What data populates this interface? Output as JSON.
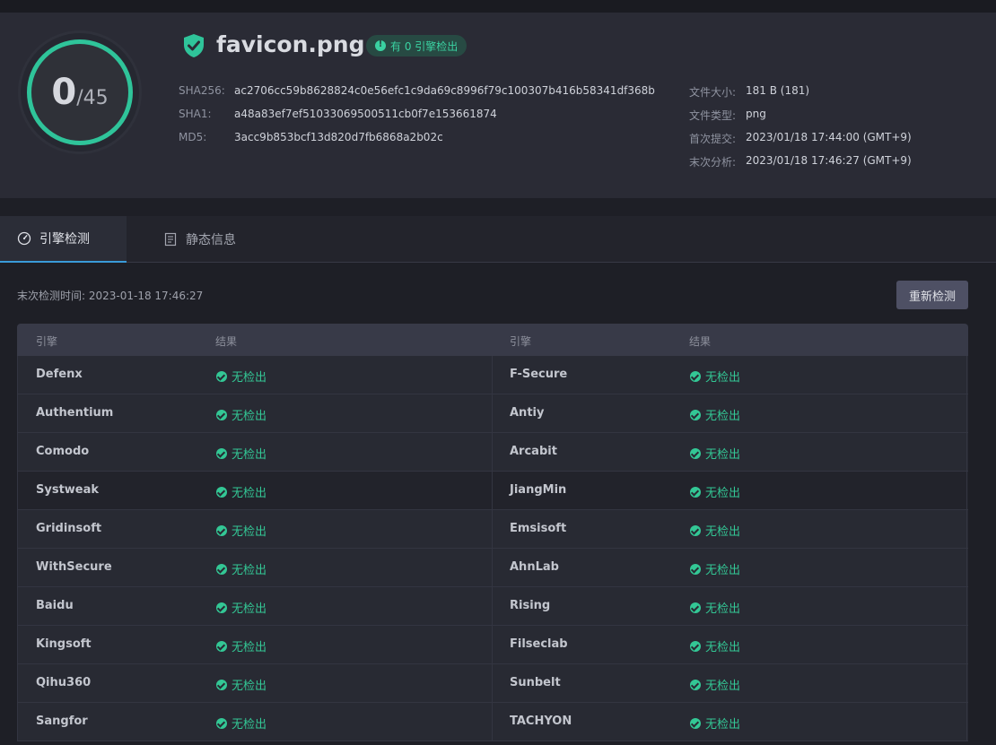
{
  "score": {
    "detected": "0",
    "total": "/45"
  },
  "file": {
    "name": "favicon.png",
    "badge": "有 0 引擎检出"
  },
  "hashes": [
    {
      "key": "SHA256:",
      "value": "ac2706cc59b8628824c0e56efc1c9da69c8996f79c100307b416b58341df368b"
    },
    {
      "key": "SHA1:",
      "value": "a48a83ef7ef51033069500511cb0f7e153661874"
    },
    {
      "key": "MD5:",
      "value": "3acc9b853bcf13d820d7fb6868a2b02c"
    }
  ],
  "meta": [
    {
      "key": "文件大小:",
      "value": "181 B (181)"
    },
    {
      "key": "文件类型:",
      "value": "png"
    },
    {
      "key": "首次提交:",
      "value": "2023/01/18 17:44:00 (GMT+9)"
    },
    {
      "key": "末次分析:",
      "value": "2023/01/18 17:46:27 (GMT+9)"
    }
  ],
  "tabs": {
    "engine": "引擎检测",
    "static": "静态信息"
  },
  "last_check": "末次检测时间: 2023-01-18 17:46:27",
  "rescan_label": "重新检测",
  "table": {
    "headers": {
      "engine": "引擎",
      "result": "结果"
    },
    "rows": [
      {
        "left": {
          "engine": "Defenx",
          "result": "无检出"
        },
        "right": {
          "engine": "F-Secure",
          "result": "无检出"
        }
      },
      {
        "left": {
          "engine": "Authentium",
          "result": "无检出"
        },
        "right": {
          "engine": "Antiy",
          "result": "无检出"
        }
      },
      {
        "left": {
          "engine": "Comodo",
          "result": "无检出"
        },
        "right": {
          "engine": "Arcabit",
          "result": "无检出"
        }
      },
      {
        "left": {
          "engine": "Systweak",
          "result": "无检出"
        },
        "right": {
          "engine": "JiangMin",
          "result": "无检出"
        }
      },
      {
        "left": {
          "engine": "Gridinsoft",
          "result": "无检出"
        },
        "right": {
          "engine": "Emsisoft",
          "result": "无检出"
        }
      },
      {
        "left": {
          "engine": "WithSecure",
          "result": "无检出"
        },
        "right": {
          "engine": "AhnLab",
          "result": "无检出"
        }
      },
      {
        "left": {
          "engine": "Baidu",
          "result": "无检出"
        },
        "right": {
          "engine": "Rising",
          "result": "无检出"
        }
      },
      {
        "left": {
          "engine": "Kingsoft",
          "result": "无检出"
        },
        "right": {
          "engine": "Filseclab",
          "result": "无检出"
        }
      },
      {
        "left": {
          "engine": "Qihu360",
          "result": "无检出"
        },
        "right": {
          "engine": "Sunbelt",
          "result": "无检出"
        }
      },
      {
        "left": {
          "engine": "Sangfor",
          "result": "无检出"
        },
        "right": {
          "engine": "TACHYON",
          "result": "无检出"
        }
      }
    ]
  },
  "colors": {
    "accent": "#2fc49a",
    "clean": "#33c795",
    "tab_indicator": "#3a9bd9"
  },
  "icons": {
    "shield": "shield-check-icon",
    "badge": "alert-circle-icon",
    "tab_engine": "gauge-icon",
    "tab_static": "document-icon",
    "result": "check-circle-icon"
  }
}
